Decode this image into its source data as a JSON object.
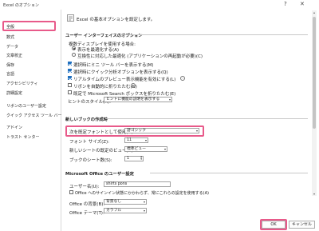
{
  "window": {
    "title": "Excel のオプション",
    "help": "?",
    "close": "✕"
  },
  "sidebar": {
    "items": [
      {
        "label": "全般"
      },
      {
        "label": "数式"
      },
      {
        "label": "データ"
      },
      {
        "label": "文章校正"
      },
      {
        "label": "保存"
      },
      {
        "label": "言語"
      },
      {
        "label": "アクセシビリティ"
      },
      {
        "label": "詳細設定"
      },
      {
        "label": "リボンのユーザー設定"
      },
      {
        "label": "クイック アクセス ツール バー"
      },
      {
        "label": "アドイン"
      },
      {
        "label": "トラスト センター"
      }
    ]
  },
  "header": {
    "text": "Excel の基本オプションを設定します。"
  },
  "ui": {
    "heading": "ユーザー インターフェイスのオプション",
    "multi_display": "複数ディスプレイを使用する場合:",
    "radio1": "表示を最適化する(A)",
    "radio2": "互換性に対応した最適化 (アプリケーションの再起動が必要)(C)",
    "cb_minitoolbar": "選択時にミニ ツール バーを表示する(M)",
    "cb_quickanalysis": "選択時にクイック分析オプションを表示する(Q)",
    "cb_livepreview": "リアルタイムのプレビュー表示機能を有効にする(L)",
    "cb_collapse": "リボンを自動的に折りたたむ(N)",
    "cb_search": "既定で Microsoft Search ボックスを折りたたむ(E)",
    "tooltip_label": "ヒントのスタイル(R):",
    "tooltip_value": "ヒントに機能の説明を表示する"
  },
  "newbook": {
    "heading": "新しいブックの作成時",
    "font_label": "次を既定フォントとして使用(N):",
    "font_value": "游ゴシック",
    "size_label": "フォント サイズ(Z):",
    "size_value": "11",
    "view_label": "新しいシートの既定のビュー(V):",
    "view_value": "標準ビュー",
    "sheets_label": "ブックのシート数(S):",
    "sheets_value": "1"
  },
  "office": {
    "heading": "Microsoft Office のユーザー設定",
    "username_label": "ユーザー名(U):",
    "username_value": "shirts pons",
    "cb_always": "Office へのサインイン状態にかかわらず、常にこれらの設定を使用する(A)",
    "background_label": "Office の背景(B):",
    "background_value": "背景なし",
    "theme_label": "Office テーマ(T):",
    "theme_value": "カラフル"
  },
  "footer": {
    "ok": "OK",
    "cancel": "キャンセル"
  },
  "colors": {
    "highlight": "#e85a8a",
    "accent": "#1f6fbf"
  },
  "icons": [
    "help-icon",
    "close-icon",
    "options-icon",
    "radio",
    "checkbox",
    "dropdown-arrow-icon",
    "info-icon"
  ]
}
